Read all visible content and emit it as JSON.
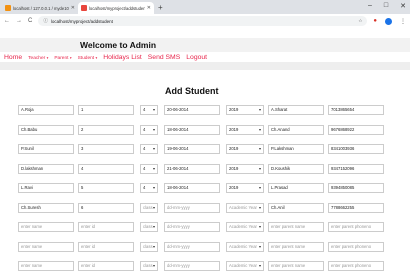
{
  "browser": {
    "tabs": [
      {
        "title": "localhost / 127.0.0.1 / myde10...",
        "active": false
      },
      {
        "title": "localhost/myproject/addstuden...",
        "active": true
      }
    ],
    "new_tab": "+",
    "window_controls": [
      "–",
      "□",
      "✕"
    ],
    "url_protocol": "ⓘ",
    "url": "localhost/myproject/addstudent",
    "nav": {
      "back": "←",
      "forward": "→",
      "reload": "C"
    },
    "star": "☆"
  },
  "header": {
    "title": "Welcome to Admin"
  },
  "nav": {
    "home": "Home",
    "teacher": "Teacher",
    "parent": "Parent",
    "student": "Student",
    "holidays": "Holidays List",
    "send_sms": "Send SMS",
    "logout": "Logout",
    "caret": "▾"
  },
  "form": {
    "heading": "Add Student",
    "rows": [
      {
        "name": "A.Roja",
        "id": "1",
        "class": "4",
        "dob": "20-06-2014",
        "year": "2019",
        "parent": "A.Sharat",
        "phone": "7013865654"
      },
      {
        "name": "Ch.Babu",
        "id": "2",
        "class": "4",
        "dob": "18-06-2014",
        "year": "2019",
        "parent": "Ch.Anand",
        "phone": "9676868922"
      },
      {
        "name": "P.Sunil",
        "id": "3",
        "class": "4",
        "dob": "19-06-2014",
        "year": "2019",
        "parent": "P.Lakshman",
        "phone": "8341003936"
      },
      {
        "name": "D.lakshman",
        "id": "4",
        "class": "4",
        "dob": "21-06-2014",
        "year": "2019",
        "parent": "D.Koushik",
        "phone": "9347152096"
      },
      {
        "name": "L.Ravi",
        "id": "5",
        "class": "4",
        "dob": "18-06-2014",
        "year": "2019",
        "parent": "L.Prasad",
        "phone": "9394850085"
      },
      {
        "name": "Ch.Suresh",
        "id": "6",
        "class": "class",
        "dob": "dd-mm-yyyy",
        "year": "Academic Year",
        "parent": "Ch.Anil",
        "phone": "7788662255"
      }
    ],
    "empty_rows": 3,
    "placeholders": {
      "name": "enter name",
      "id": "enter id",
      "class": "class",
      "dob": "dd-mm-yyyy",
      "year": "Academic Year",
      "parent": "enter parent name",
      "phone": "enter parent phoneno"
    }
  }
}
